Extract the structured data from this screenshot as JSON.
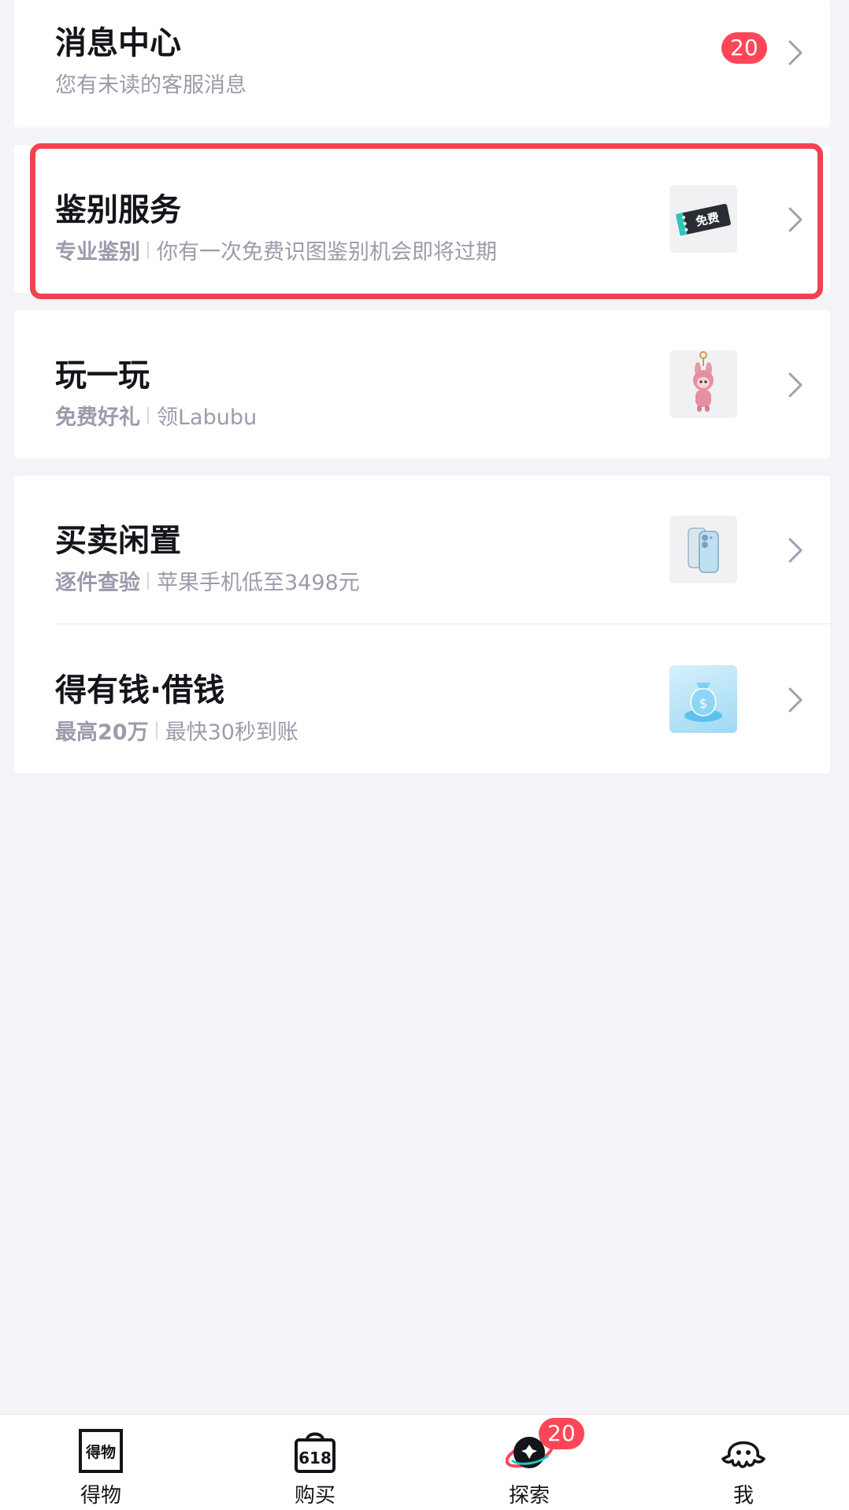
{
  "message_center": {
    "title": "消息中心",
    "subtitle": "您有未读的客服消息",
    "badge": "20"
  },
  "authentication": {
    "title": "鉴别服务",
    "tag": "专业鉴别",
    "subtitle": "你有一次免费识图鉴别机会即将过期",
    "thumb_text": "免费",
    "thumb_icon": "free-ticket-icon"
  },
  "play": {
    "title": "玩一玩",
    "tag": "免费好礼",
    "subtitle": "领Labubu",
    "thumb_icon": "labubu-keychain-icon"
  },
  "secondhand": {
    "title": "买卖闲置",
    "tag": "逐件查验",
    "subtitle": "苹果手机低至3498元",
    "thumb_icon": "iphone-icon"
  },
  "loan": {
    "title": "得有钱·借钱",
    "tag": "最高20万",
    "subtitle": "最快30秒到账",
    "thumb_icon": "money-bag-icon"
  },
  "tabbar": {
    "items": [
      {
        "label": "得物",
        "icon": "dewu-logo-icon"
      },
      {
        "label": "购买",
        "icon": "shopping-bag-618-icon"
      },
      {
        "label": "探索",
        "icon": "planet-explore-icon",
        "badge": "20"
      },
      {
        "label": "我",
        "icon": "octopus-profile-icon"
      }
    ]
  },
  "colors": {
    "badge": "#ff4657",
    "highlight": "#ef4450",
    "background": "#f3f3f8",
    "subtitle": "#9b9bab"
  }
}
